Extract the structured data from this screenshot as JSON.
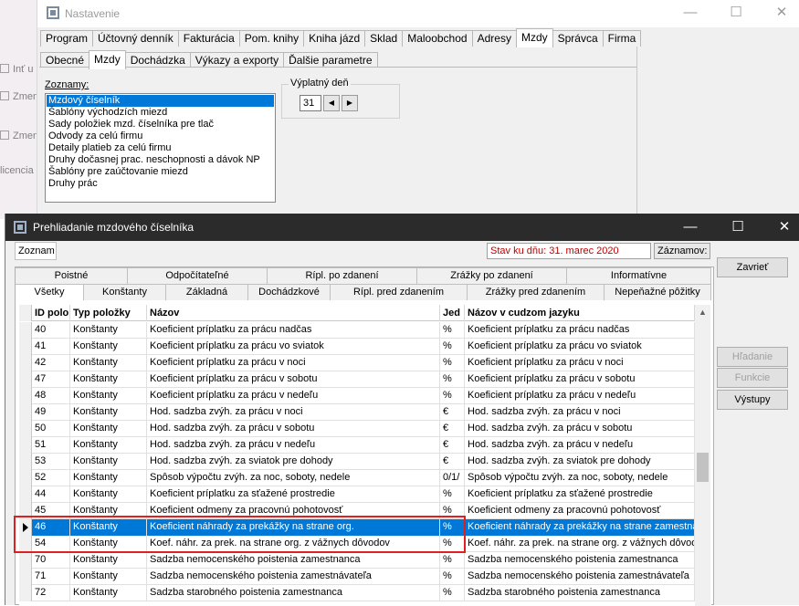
{
  "background_strip": {
    "items": [
      "Inť u",
      "Zmen",
      "Zmen",
      "licencia Y"
    ]
  },
  "settings_window": {
    "title": "Nastavenie",
    "main_tabs": [
      "Program",
      "Účtovný denník",
      "Fakturácia",
      "Pom. knihy",
      "Kniha jázd",
      "Sklad",
      "Maloobchod",
      "Adresy",
      "Mzdy",
      "Správca",
      "Firma"
    ],
    "active_main_tab": "Mzdy",
    "sub_tabs": [
      "Obecné",
      "Mzdy",
      "Dochádzka",
      "Výkazy a exporty",
      "Ďalšie parametre"
    ],
    "active_sub_tab": "Mzdy",
    "lists_label": "Zoznamy:",
    "lists": [
      "Mzdový číselník",
      "Šablóny východzích miezd",
      "Sady položiek mzd. číselníka pre tlač",
      "Odvody za celú firmu",
      "Detaily platieb za celú firmu",
      "Druhy dočasnej prac. neschopnosti a dávok NP",
      "Šablóny pre zaúčtovanie miezd",
      "Druhy prác"
    ],
    "selected_list": "Mzdový číselník",
    "payday_label": "Výplatný deň",
    "payday_value": "31"
  },
  "browse_window": {
    "title": "Prehliadanie mzdového číselníka",
    "list_label": "Zoznam",
    "status_text": "Stav ku dňu: 31. marec 2020",
    "records_label": "Záznamov:",
    "tabs_row1": [
      "Poistné",
      "Odpočítateľné",
      "Rípl. po zdanení",
      "Zrážky po zdanení",
      "Informatívne"
    ],
    "tabs_row2": [
      "Všetky",
      "Konštanty",
      "Základná",
      "Dochádzkové",
      "Rípl. pred zdanením",
      "Zrážky pred zdanením",
      "Nepeňažné pôžitky"
    ],
    "active_tab": "Všetky",
    "columns": [
      "ID polo",
      "Typ položky",
      "Názov",
      "Jed",
      "Názov v cudzom jazyku"
    ],
    "rows": [
      {
        "id": "40",
        "type": "Konštanty",
        "name": "Koeficient príplatku za prácu nadčas",
        "unit": "%",
        "foreign": "Koeficient príplatku za prácu nadčas"
      },
      {
        "id": "41",
        "type": "Konštanty",
        "name": "Koeficient príplatku za prácu vo sviatok",
        "unit": "%",
        "foreign": "Koeficient príplatku za prácu vo sviatok"
      },
      {
        "id": "42",
        "type": "Konštanty",
        "name": "Koeficient príplatku za prácu v noci",
        "unit": "%",
        "foreign": "Koeficient príplatku za prácu v noci"
      },
      {
        "id": "47",
        "type": "Konštanty",
        "name": "Koeficient príplatku za prácu v sobotu",
        "unit": "%",
        "foreign": "Koeficient príplatku za prácu v sobotu"
      },
      {
        "id": "48",
        "type": "Konštanty",
        "name": "Koeficient príplatku za prácu v nedeľu",
        "unit": "%",
        "foreign": "Koeficient príplatku za prácu v nedeľu"
      },
      {
        "id": "49",
        "type": "Konštanty",
        "name": "Hod. sadzba zvýh. za prácu v noci",
        "unit": "€",
        "foreign": "Hod. sadzba zvýh. za prácu v noci"
      },
      {
        "id": "50",
        "type": "Konštanty",
        "name": "Hod. sadzba zvýh. za prácu v sobotu",
        "unit": "€",
        "foreign": "Hod. sadzba zvýh. za prácu v sobotu"
      },
      {
        "id": "51",
        "type": "Konštanty",
        "name": "Hod. sadzba zvýh. za prácu v nedeľu",
        "unit": "€",
        "foreign": "Hod. sadzba zvýh. za prácu v nedeľu"
      },
      {
        "id": "53",
        "type": "Konštanty",
        "name": "Hod. sadzba zvýh. za sviatok pre dohody",
        "unit": "€",
        "foreign": "Hod. sadzba zvýh. za sviatok pre dohody"
      },
      {
        "id": "52",
        "type": "Konštanty",
        "name": "Spôsob výpočtu zvýh. za noc, soboty, nedele",
        "unit": "0/1/",
        "foreign": "Spôsob výpočtu zvýh. za noc, soboty, nedele"
      },
      {
        "id": "44",
        "type": "Konštanty",
        "name": "Koeficient príplatku za sťažené prostredie",
        "unit": "%",
        "foreign": "Koeficient príplatku za sťažené prostredie"
      },
      {
        "id": "45",
        "type": "Konštanty",
        "name": "Koeficient odmeny za pracovnú pohotovosť",
        "unit": "%",
        "foreign": "Koeficient odmeny za pracovnú pohotovosť"
      },
      {
        "id": "46",
        "type": "Konštanty",
        "name": "Koeficient náhrady za prekážky na strane org.",
        "unit": "%",
        "foreign": "Koeficient náhrady za prekážky na strane zamestná",
        "selected": true
      },
      {
        "id": "54",
        "type": "Konštanty",
        "name": "Koef. náhr. za prek. na strane org. z vážnych dôvodov",
        "unit": "%",
        "foreign": "Koef. náhr. za prek. na strane org. z vážnych dôvod"
      },
      {
        "id": "70",
        "type": "Konštanty",
        "name": "Sadzba nemocenského poistenia zamestnanca",
        "unit": "%",
        "foreign": "Sadzba nemocenského poistenia zamestnanca"
      },
      {
        "id": "71",
        "type": "Konštanty",
        "name": "Sadzba nemocenského poistenia zamestnávateľa",
        "unit": "%",
        "foreign": "Sadzba nemocenského poistenia zamestnávateľa"
      },
      {
        "id": "72",
        "type": "Konštanty",
        "name": "Sadzba starobného poistenia zamestnanca",
        "unit": "%",
        "foreign": "Sadzba starobného poistenia zamestnanca"
      }
    ],
    "side_buttons": [
      {
        "label": "Zavrieť",
        "enabled": true
      },
      {
        "label": "Hľadanie",
        "enabled": false
      },
      {
        "label": "Funkcie",
        "enabled": false
      },
      {
        "label": "Výstupy",
        "enabled": true
      }
    ]
  },
  "colors": {
    "selection": "#0078d7",
    "highlight_border": "#e02020",
    "status_text": "#c00000",
    "dark_titlebar": "#2b2b2b"
  }
}
